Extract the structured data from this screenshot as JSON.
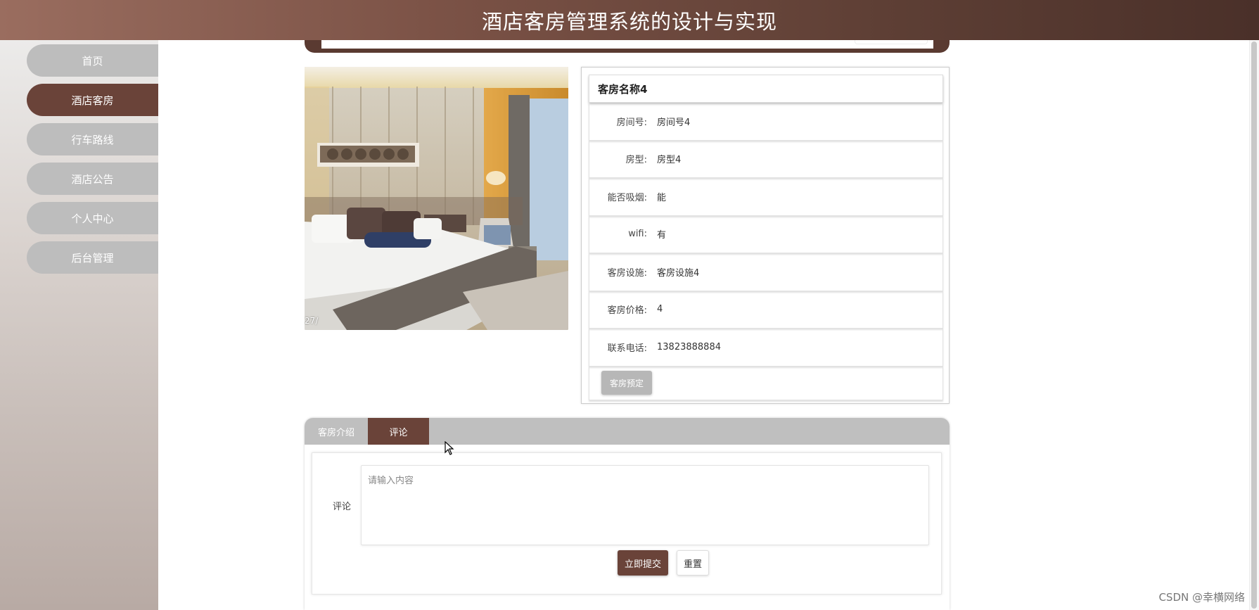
{
  "header": {
    "title": "酒店客房管理系统的设计与实现"
  },
  "sidebar": {
    "items": [
      {
        "label": "首页",
        "active": false
      },
      {
        "label": "酒店客房",
        "active": true
      },
      {
        "label": "行车路线",
        "active": false
      },
      {
        "label": "酒店公告",
        "active": false
      },
      {
        "label": "个人中心",
        "active": false
      },
      {
        "label": "后台管理",
        "active": false
      }
    ]
  },
  "room": {
    "image_caption": "27/",
    "name": "客房名称4",
    "fields": [
      {
        "label": "房间号:",
        "value": "房间号4"
      },
      {
        "label": "房型:",
        "value": "房型4"
      },
      {
        "label": "能否吸烟:",
        "value": "能"
      },
      {
        "label": "wifi:",
        "value": "有"
      },
      {
        "label": "客房设施:",
        "value": "客房设施4"
      },
      {
        "label": "客房价格:",
        "value": "4"
      },
      {
        "label": "联系电话:",
        "value": "13823888884"
      }
    ],
    "book_label": "客房预定"
  },
  "tabs": {
    "items": [
      {
        "label": "客房介绍",
        "active": false
      },
      {
        "label": "评论",
        "active": true
      }
    ]
  },
  "comment": {
    "label": "评论",
    "placeholder": "请输入内容",
    "value": "",
    "submit_label": "立即提交",
    "reset_label": "重置"
  },
  "watermark": "CSDN @幸横网络",
  "colors": {
    "accent": "#6a4339",
    "inactive": "#bdbdbd",
    "tab_bar": "#bfbfbf"
  }
}
